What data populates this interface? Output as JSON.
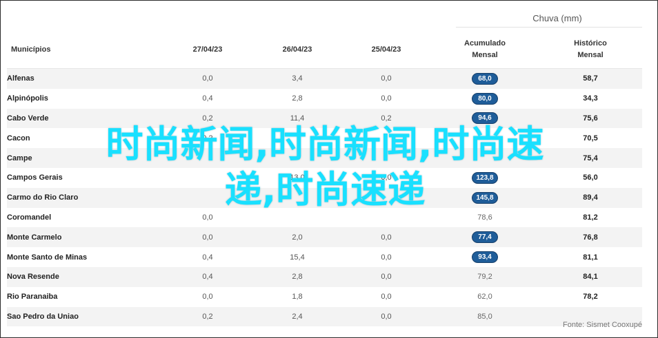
{
  "chart_data": {
    "type": "table",
    "super_header": "Chuva (mm)",
    "columns": [
      "Municípios",
      "27/04/23",
      "26/04/23",
      "25/04/23",
      "Acumulado\nMensal",
      "Histórico\nMensal"
    ],
    "rows": [
      {
        "municipio": "Alfenas",
        "d27": "0,0",
        "d26": "3,4",
        "d25": "0,0",
        "acumulado": "68,0",
        "historico": "58,7",
        "highlight": true
      },
      {
        "municipio": "Alpinópolis",
        "d27": "0,4",
        "d26": "2,8",
        "d25": "0,0",
        "acumulado": "80,0",
        "historico": "34,3",
        "highlight": true
      },
      {
        "municipio": "Cabo Verde",
        "d27": "0,2",
        "d26": "11,4",
        "d25": "0,2",
        "acumulado": "94,6",
        "historico": "75,6",
        "highlight": true
      },
      {
        "municipio": "Cacon",
        "d27": "0,2",
        "d26": "",
        "d25": "",
        "acumulado": "",
        "historico": "70,5",
        "highlight": true
      },
      {
        "municipio": "Campe",
        "d27": "",
        "d26": "",
        "d25": "",
        "acumulado": "",
        "historico": "75,4",
        "highlight": true
      },
      {
        "municipio": "Campos Gerais",
        "d27": "",
        "d26": "13,0",
        "d25": "0,0",
        "acumulado": "123,8",
        "historico": "56,0",
        "highlight": true
      },
      {
        "municipio": "Carmo do Rio Claro",
        "d27": "",
        "d26": "",
        "d25": "",
        "acumulado": "145,8",
        "historico": "89,4",
        "highlight": true
      },
      {
        "municipio": "Coromandel",
        "d27": "0,0",
        "d26": "",
        "d25": "",
        "acumulado": "78,6",
        "historico": "81,2",
        "highlight": false
      },
      {
        "municipio": "Monte Carmelo",
        "d27": "0,0",
        "d26": "2,0",
        "d25": "0,0",
        "acumulado": "77,4",
        "historico": "76,8",
        "highlight": true
      },
      {
        "municipio": "Monte Santo de Minas",
        "d27": "0,4",
        "d26": "15,4",
        "d25": "0,0",
        "acumulado": "93,4",
        "historico": "81,1",
        "highlight": true
      },
      {
        "municipio": "Nova Resende",
        "d27": "0,4",
        "d26": "2,8",
        "d25": "0,0",
        "acumulado": "79,2",
        "historico": "84,1",
        "highlight": false
      },
      {
        "municipio": "Rio Paranaiba",
        "d27": "0,0",
        "d26": "1,8",
        "d25": "0,0",
        "acumulado": "62,0",
        "historico": "78,2",
        "highlight": false
      },
      {
        "municipio": "Sao Pedro da Uniao",
        "d27": "0,2",
        "d26": "2,4",
        "d25": "0,0",
        "acumulado": "85,0",
        "historico": "",
        "highlight": false
      }
    ],
    "source": "Fonte: Sismet Cooxupé"
  },
  "overlay": {
    "line1": "时尚新闻,时尚新闻,时尚速",
    "line2": "递,时尚速递"
  },
  "colors": {
    "pill_bg": "#1f5d99",
    "overlay_text": "#19e0ff",
    "stripe": "#f3f3f3"
  }
}
